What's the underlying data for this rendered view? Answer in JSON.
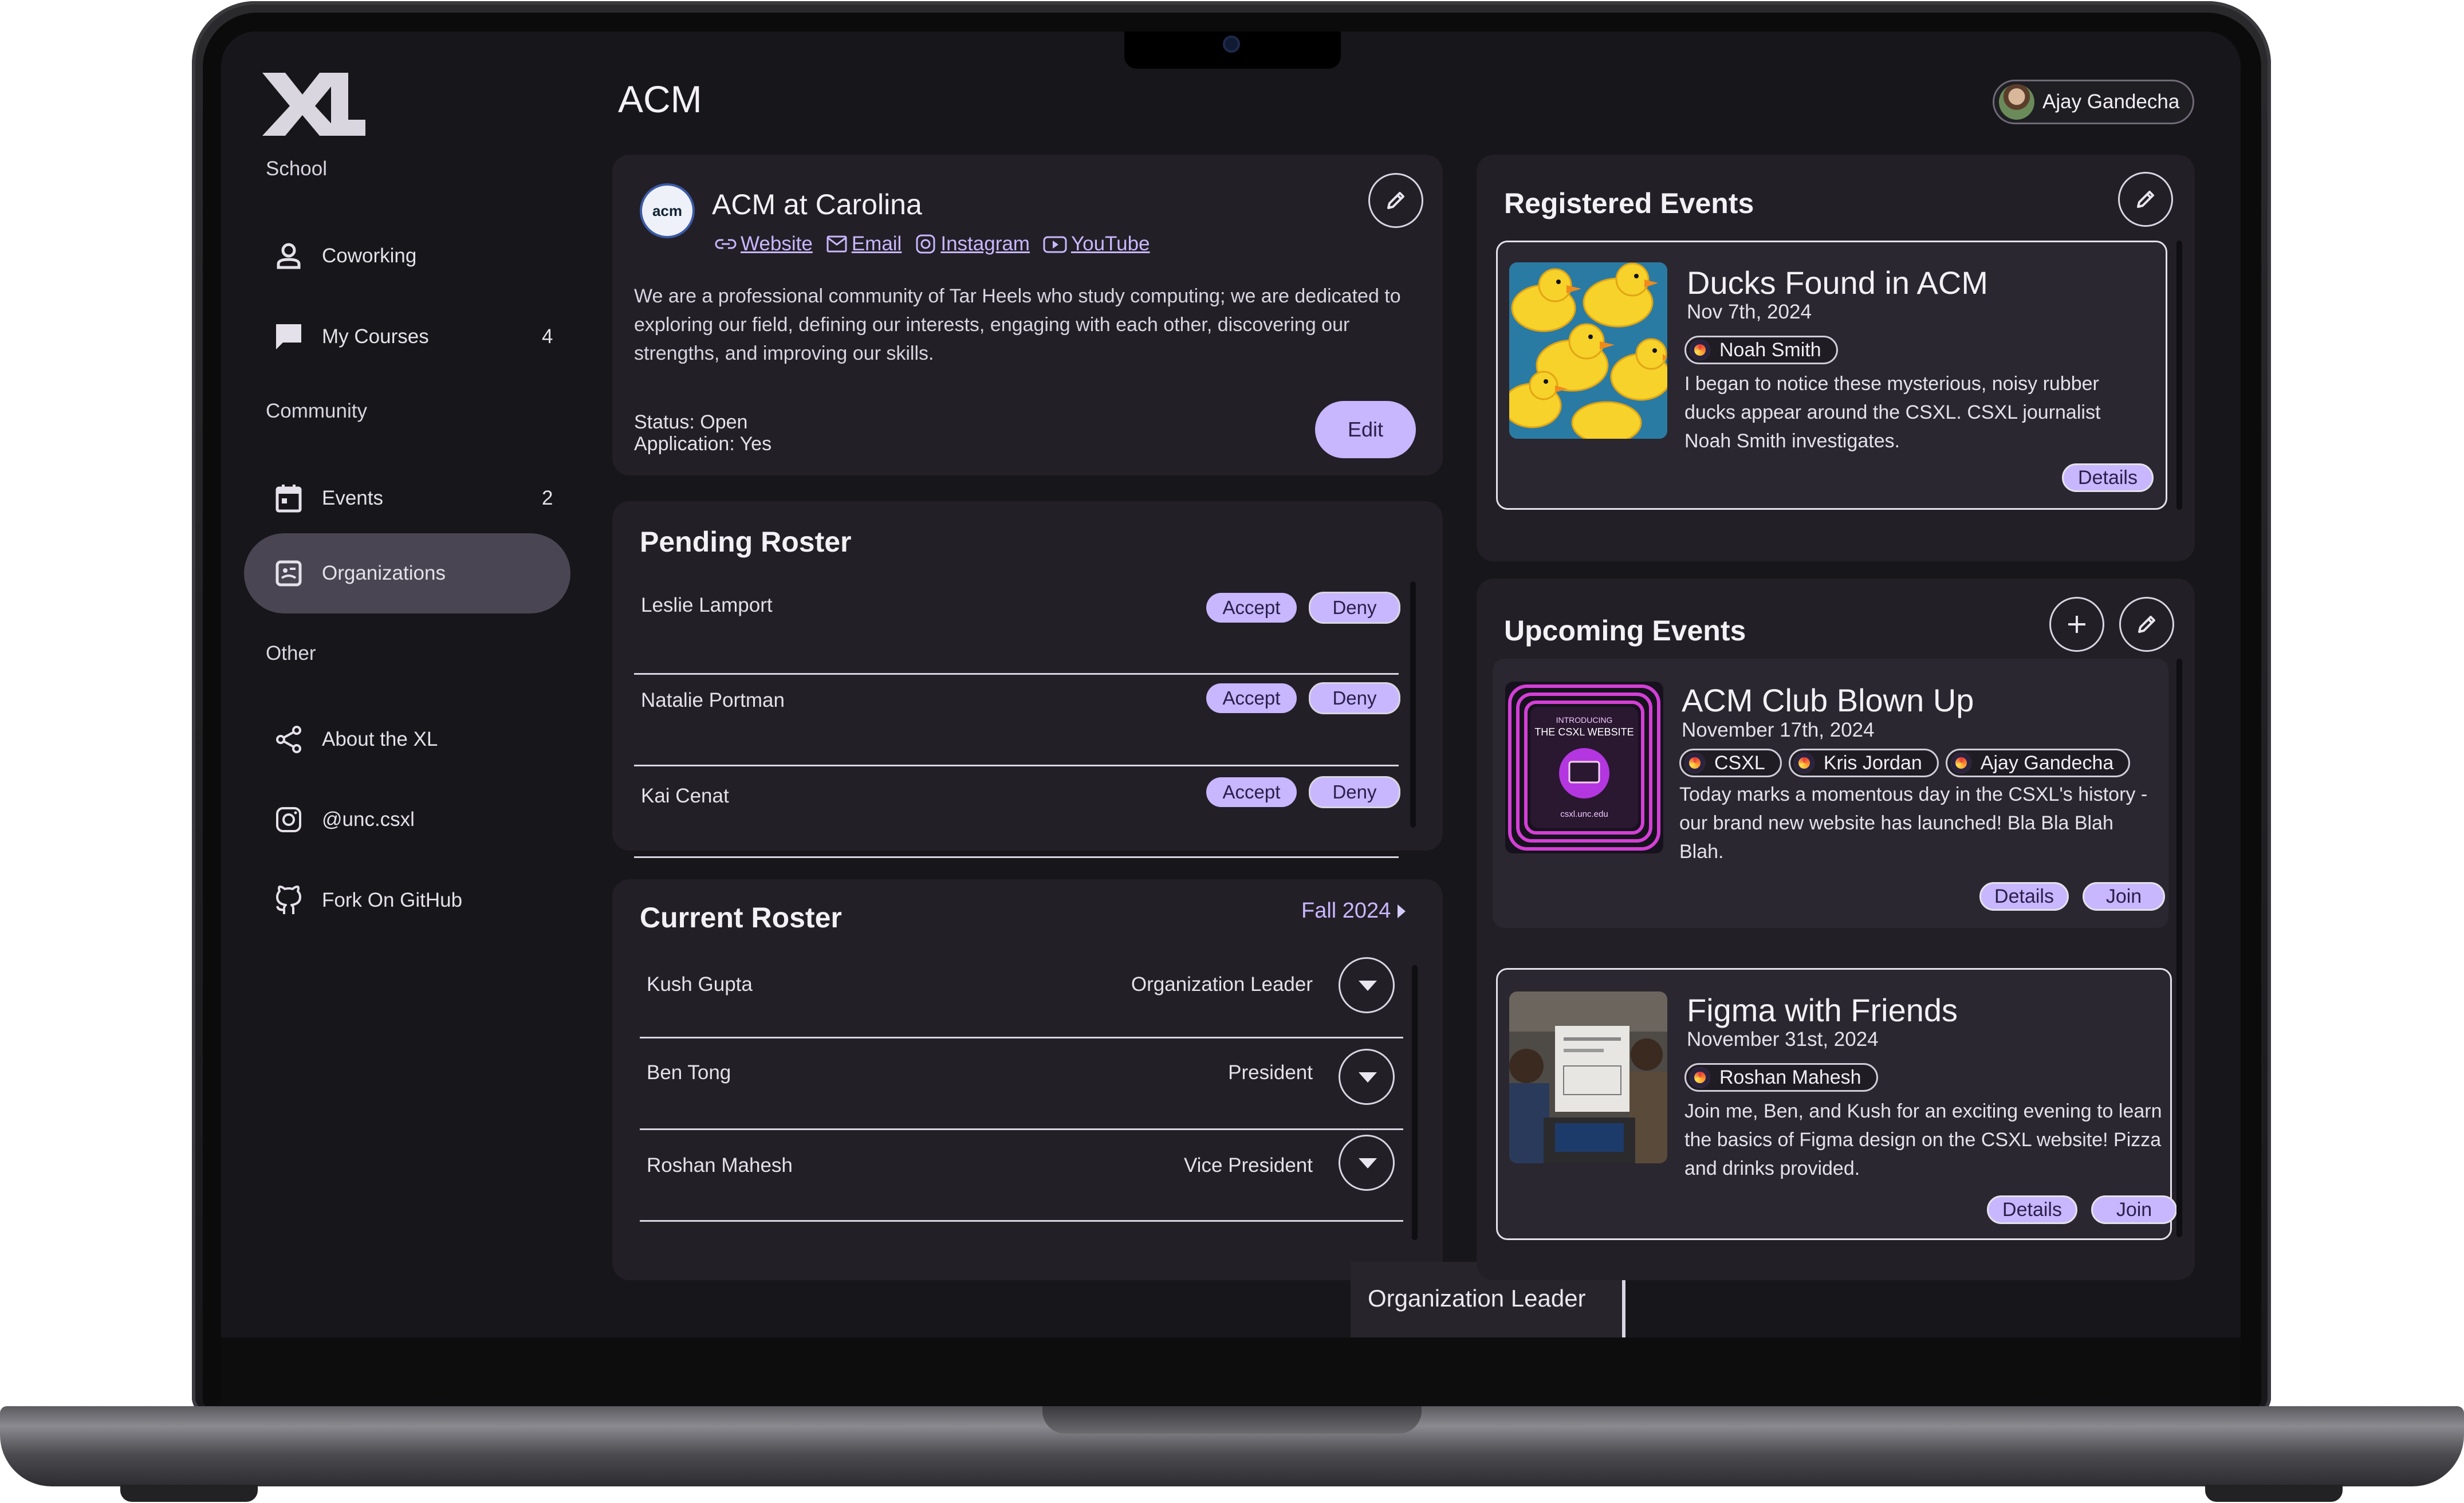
{
  "sidebar": {
    "logo": "XL",
    "sections": {
      "school": "School",
      "community": "Community",
      "other": "Other"
    },
    "items": [
      {
        "label": "Coworking",
        "icon": "person-icon",
        "count": ""
      },
      {
        "label": "My Courses",
        "icon": "chat-bubble-icon",
        "count": "4"
      },
      {
        "label": "Events",
        "icon": "calendar-icon",
        "count": "2"
      },
      {
        "label": "Organizations",
        "icon": "badge-icon",
        "count": ""
      },
      {
        "label": "About the XL",
        "icon": "share-icon",
        "count": ""
      },
      {
        "label": "@unc.csxl",
        "icon": "instagram-icon",
        "count": ""
      },
      {
        "label": "Fork On GitHub",
        "icon": "github-icon",
        "count": ""
      }
    ]
  },
  "header": {
    "title": "ACM",
    "user_name": "Ajay Gandecha"
  },
  "org": {
    "logo_text": "acm",
    "name": "ACM at Carolina",
    "links": [
      "Website",
      "Email",
      "Instagram",
      "YouTube"
    ],
    "description": "We are a professional community of Tar Heels who study computing; we are dedicated to exploring our field, defining our interests, engaging with each other, discovering our strengths, and improving our skills.",
    "status": "Status: Open",
    "application": "Application: Yes",
    "edit_label": "Edit"
  },
  "pending": {
    "title": "Pending Roster",
    "accept_label": "Accept",
    "deny_label": "Deny",
    "rows": [
      "Leslie Lamport",
      "Natalie Portman",
      "Kai Cenat"
    ]
  },
  "current": {
    "title": "Current Roster",
    "semester": "Fall 2024",
    "rows": [
      {
        "name": "Kush Gupta",
        "role": "Organization Leader"
      },
      {
        "name": "Ben Tong",
        "role": "President"
      },
      {
        "name": "Roshan Mahesh",
        "role": "Vice President"
      }
    ],
    "dropdown_option": "Organization Leader"
  },
  "registered": {
    "title": "Registered Events",
    "event": {
      "title": "Ducks Found in ACM",
      "date": "Nov 7th, 2024",
      "people": [
        "Noah Smith"
      ],
      "description": "I began to notice these mysterious, noisy rubber ducks appear around the CSXL. CSXL journalist Noah Smith investigates.",
      "details_label": "Details"
    }
  },
  "upcoming": {
    "title": "Upcoming Events",
    "events": [
      {
        "title": "ACM Club Blown Up",
        "date": "November 17th, 2024",
        "people": [
          "CSXL",
          "Kris Jordan",
          "Ajay Gandecha"
        ],
        "description": "Today marks a momentous day in the CSXL's history - our brand new website has launched! Bla Bla Blah Blah.",
        "image_text_top": "INTRODUCING",
        "image_text_mid": "THE CSXL WEBSITE",
        "image_text_bottom": "csxl.unc.edu",
        "details_label": "Details",
        "join_label": "Join"
      },
      {
        "title": "Figma with Friends",
        "date": "November 31st, 2024",
        "people": [
          "Roshan Mahesh"
        ],
        "description": "Join me, Ben, and Kush for an exciting evening to learn the basics of Figma design on the CSXL website! Pizza and drinks provided.",
        "details_label": "Details",
        "join_label": "Join"
      }
    ]
  }
}
